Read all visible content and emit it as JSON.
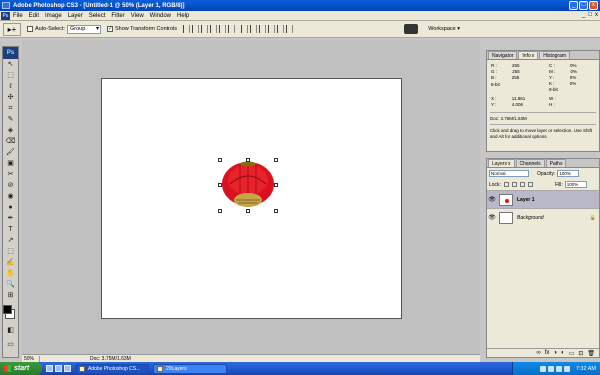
{
  "window": {
    "title": "Adobe Photoshop CS3 - [Untitled-1 @ 50% (Layer 1, RGB/8)]",
    "controls": [
      "_",
      "□",
      "x"
    ],
    "mdi_controls": [
      "_",
      "□",
      "x"
    ]
  },
  "menu": {
    "app_badge": "Ps",
    "items": [
      "File",
      "Edit",
      "Image",
      "Layer",
      "Select",
      "Filter",
      "View",
      "Window",
      "Help"
    ]
  },
  "options": {
    "tool_glyph": "▸+",
    "auto_select_label": "Auto-Select:",
    "auto_select_checked": false,
    "auto_select_value": "Group",
    "show_transform_label": "Show Transform Controls",
    "show_transform_checked": true,
    "workspace_label": "Workspace ▾"
  },
  "toolbox": {
    "logo": "Ps",
    "tools": [
      "↖",
      "⬚",
      "ℓ",
      "✣",
      "⌗",
      "✎",
      "◈",
      "⌫",
      "🖌",
      "▣",
      "✂",
      "⊘",
      "◉",
      "●",
      "✒",
      "T",
      "↗",
      "⬚",
      "✍",
      "✋",
      "🔍",
      "⊞"
    ],
    "foreground_color": "#000000",
    "background_color": "#ffffff"
  },
  "status": {
    "zoom": "50%",
    "doc": "Doc: 3.75M/1.63M"
  },
  "info_panel": {
    "tabs": [
      "Navigator",
      "Info",
      "Histogram"
    ],
    "active_tab": "Info",
    "rgb": [
      {
        "l": "R :",
        "v": "255"
      },
      {
        "l": "G :",
        "v": "255"
      },
      {
        "l": "B :",
        "v": "255"
      }
    ],
    "rgb_bits": "8-bit",
    "cmyk": [
      {
        "l": "C :",
        "v": "0%"
      },
      {
        "l": "M :",
        "v": "0%"
      },
      {
        "l": "Y :",
        "v": "0%"
      },
      {
        "l": "K :",
        "v": "0%"
      }
    ],
    "cmyk_bits": "8-bit",
    "xy": [
      {
        "l": "X :",
        "v": "11.861"
      },
      {
        "l": "Y :",
        "v": "4.006"
      }
    ],
    "wh": [
      {
        "l": "W :",
        "v": ""
      },
      {
        "l": "H :",
        "v": ""
      }
    ],
    "doc": "Doc: 3.75M/1.63M",
    "help": "Click and drag to move layer or selection. Use Shift and Alt for additional options."
  },
  "layers_panel": {
    "tabs": [
      "Layers",
      "Channels",
      "Paths"
    ],
    "active_tab": "Layers",
    "blend_mode": "Normal",
    "opacity_label": "Opacity:",
    "opacity_value": "100%",
    "lock_label": "Lock:",
    "fill_label": "Fill:",
    "fill_value": "100%",
    "layers": [
      {
        "name": "Layer 1",
        "selected": true
      },
      {
        "name": "Background",
        "selected": false,
        "locked": true
      }
    ],
    "footer_icons": [
      "∞",
      "fx",
      "◑",
      "◐",
      "▭",
      "⊡",
      "🗑"
    ]
  },
  "taskbar": {
    "start_label": "start",
    "tasks": [
      {
        "label": "Adobe Photoshop CS...",
        "active": true
      },
      {
        "label": "20Layers",
        "active": false
      }
    ],
    "clock": "7:32 AM"
  },
  "colors": {
    "lantern_red": "#d9121e",
    "lantern_gold": "#c9a54a",
    "titlebar_blue": "#0a5fd8"
  }
}
